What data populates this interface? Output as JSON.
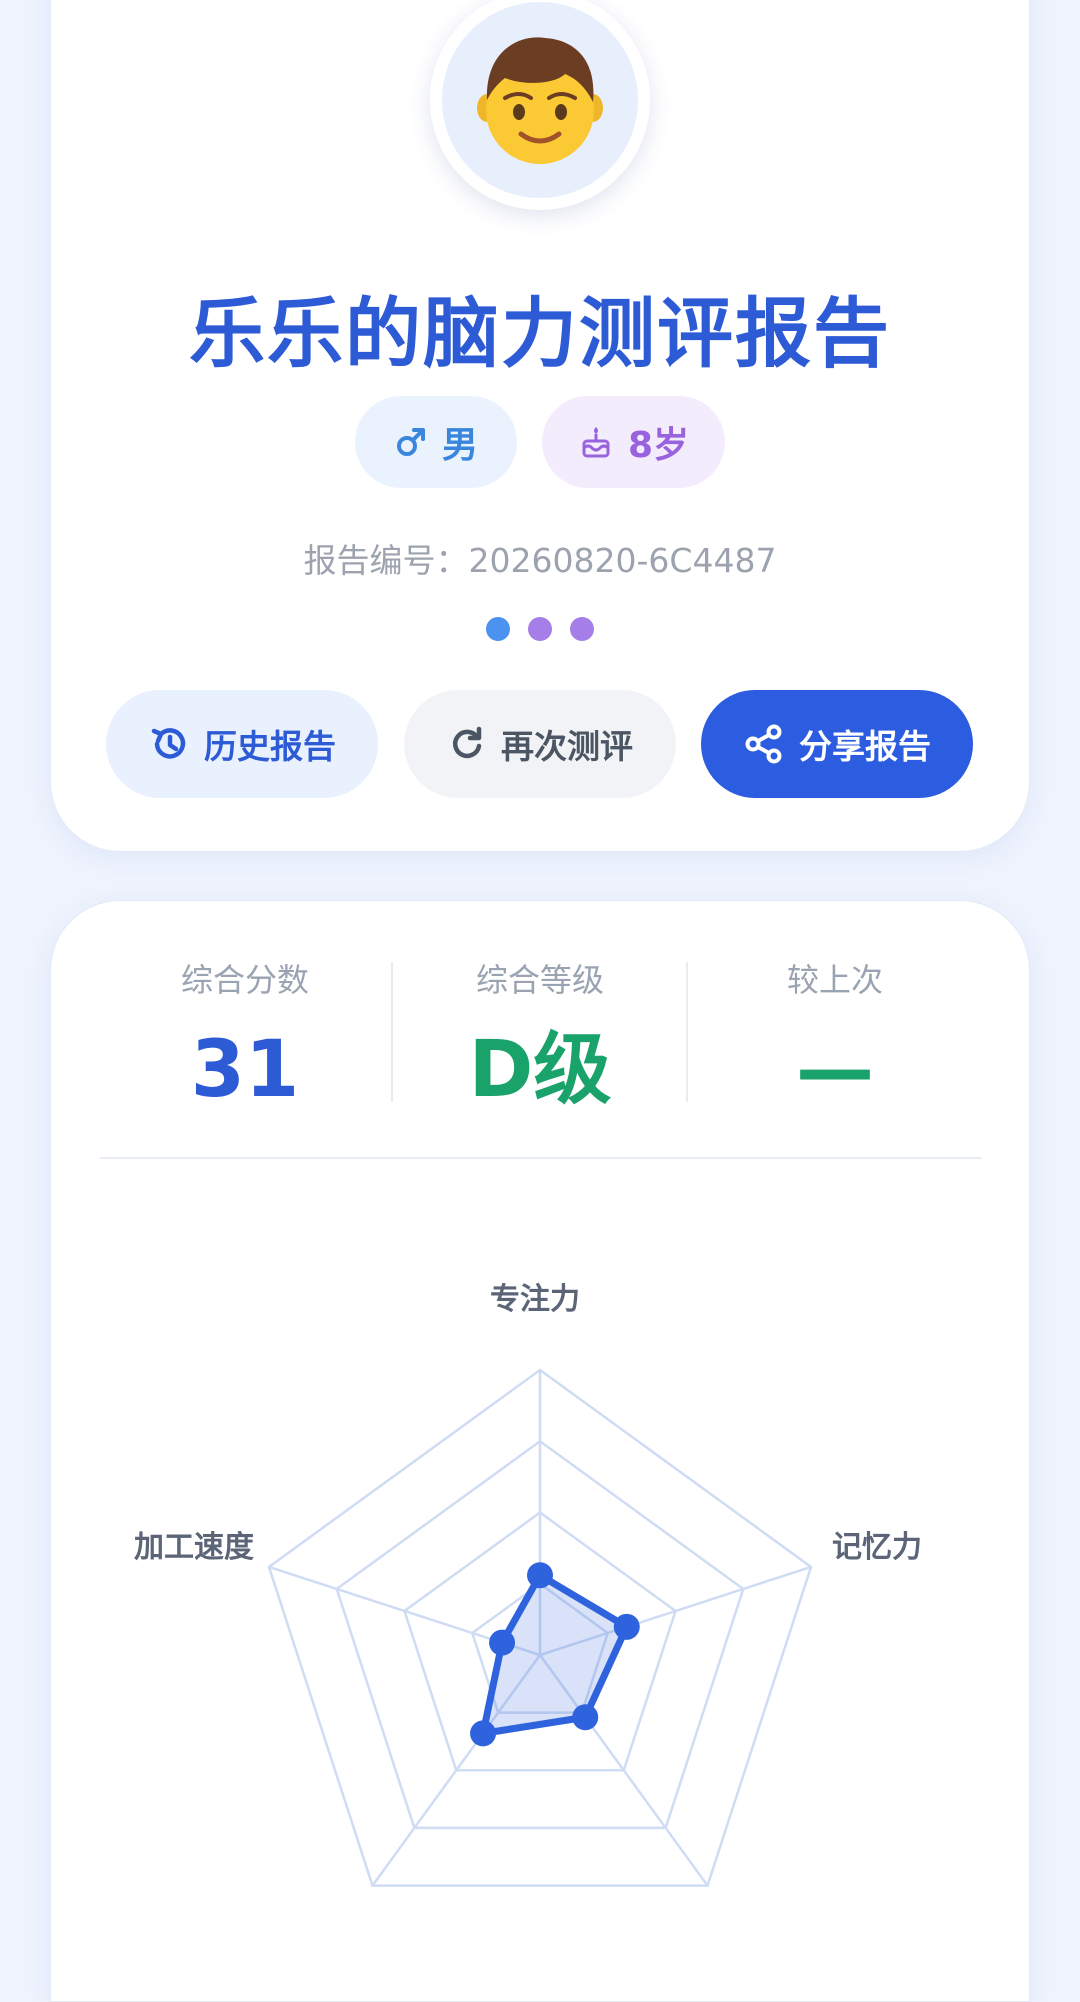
{
  "profile": {
    "avatar_icon": "boy-face-icon",
    "title": "乐乐的脑力测评报告",
    "gender_icon": "male-symbol-icon",
    "gender": "男",
    "age_icon": "birthday-cake-icon",
    "age": "8岁",
    "report_id": "报告编号：20260820-6C4487"
  },
  "actions": {
    "history_label": "历史报告",
    "retest_label": "再次测评",
    "share_label": "分享报告"
  },
  "stats": {
    "score_label": "综合分数",
    "score_value": "31",
    "grade_label": "综合等级",
    "grade_value": "D级",
    "compare_label": "较上次",
    "compare_value": "—"
  },
  "colors": {
    "primary": "#2c5ce0",
    "title": "#2d5bd6",
    "grade": "#19a36a",
    "dot_blue": "#4b93ee",
    "dot_purple": "#a57ee8"
  },
  "chart_data": {
    "type": "radar",
    "axes": [
      "专注力",
      "记忆力",
      "",
      "",
      "加工速度"
    ],
    "levels": 4,
    "max": 100,
    "values": [
      28,
      32,
      27,
      34,
      14
    ]
  }
}
